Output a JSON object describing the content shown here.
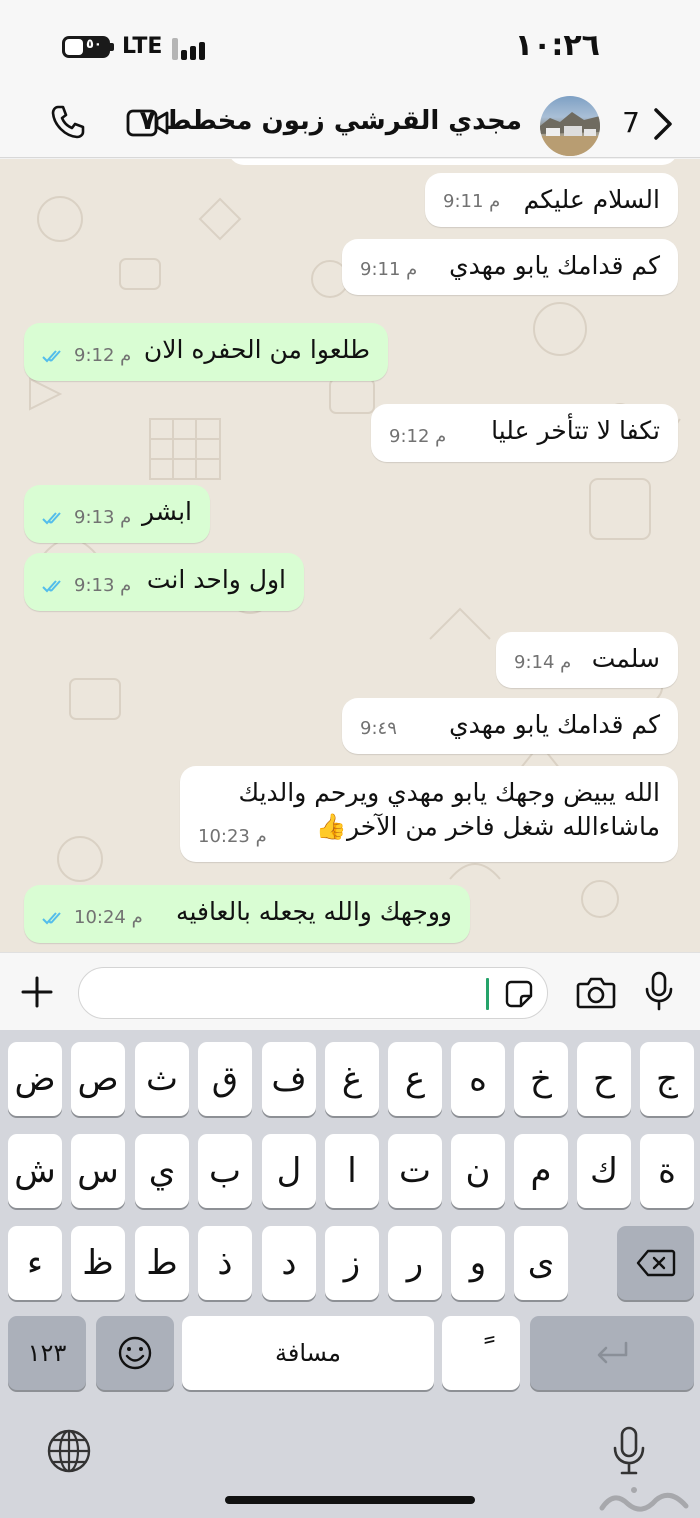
{
  "status_bar": {
    "time": "١٠:٢٦",
    "network": "LTE",
    "battery_text": "٥٠"
  },
  "header": {
    "back_count": "7",
    "contact_name": "مجدي القرشي زبون مخطط ٧"
  },
  "messages": [
    {
      "direction": "incoming",
      "text": "السلام عليكم",
      "time": "9:11 م"
    },
    {
      "direction": "incoming",
      "text": "كم قدامك يابو مهدي",
      "time": "9:11 م"
    },
    {
      "direction": "outgoing",
      "text": "طلعوا من الحفره الان",
      "time": "9:12 م",
      "read": true
    },
    {
      "direction": "incoming",
      "text": "تكفا لا تتأخر عليا",
      "time": "9:12 م"
    },
    {
      "direction": "outgoing",
      "text": "ابشر",
      "time": "9:13 م",
      "read": true
    },
    {
      "direction": "outgoing",
      "text": "اول واحد انت",
      "time": "9:13 م",
      "read": true
    },
    {
      "direction": "incoming",
      "text": "سلمت",
      "time": "9:14 م"
    },
    {
      "direction": "incoming",
      "text": "كم قدامك يابو مهدي",
      "time": "9:٤٩"
    },
    {
      "direction": "incoming",
      "line1": "الله يبيض وجهك يابو مهدي ويرحم والديك",
      "line2": "ماشاءالله شغل فاخر من الآخر👍",
      "time": "10:23 م"
    },
    {
      "direction": "outgoing",
      "text": "ووجهك والله يجعله بالعافيه",
      "time": "10:24 م",
      "read": true
    }
  ],
  "keyboard": {
    "row1": [
      "ض",
      "ص",
      "ث",
      "ق",
      "ف",
      "غ",
      "ع",
      "ه",
      "خ",
      "ح",
      "ج"
    ],
    "row2": [
      "ش",
      "س",
      "ي",
      "ب",
      "ل",
      "ا",
      "ت",
      "ن",
      "م",
      "ك",
      "ة"
    ],
    "row3": [
      "ء",
      "ظ",
      "ط",
      "ذ",
      "د",
      "ز",
      "ر",
      "و",
      "ى"
    ],
    "numbers_key": "١٢٣",
    "space_key": "مسافة",
    "diacritic_key": "ً"
  },
  "colors": {
    "outgoing_bubble": "#d9fdd3",
    "incoming_bubble": "#ffffff",
    "read_ticks": "#53bdeb",
    "cursor": "#25a36a"
  }
}
